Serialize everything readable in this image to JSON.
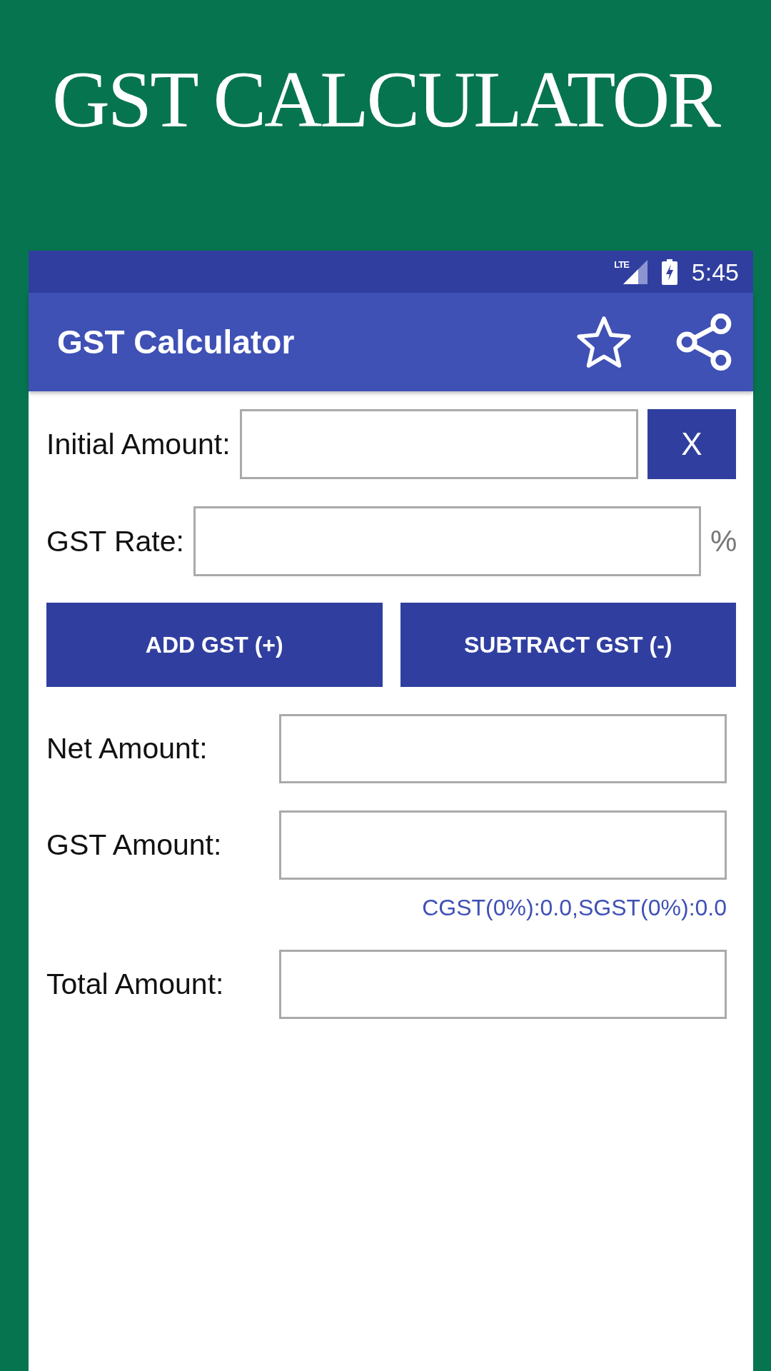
{
  "banner": {
    "title": "GST CALCULATOR"
  },
  "status_bar": {
    "network": "LTE",
    "time": "5:45"
  },
  "app_bar": {
    "title": "GST Calculator"
  },
  "inputs": [
    {
      "label": "Initial Amount:",
      "clear_button": "X"
    },
    {
      "label": "GST Rate:",
      "suffix": "%"
    }
  ],
  "actions": [
    {
      "label": "ADD GST (+)"
    },
    {
      "label": "SUBTRACT GST (-)"
    }
  ],
  "results": [
    {
      "label": "Net Amount:"
    },
    {
      "label": "GST Amount:",
      "note": "CGST(0%):0.0,SGST(0%):0.0"
    },
    {
      "label": "Total Amount:"
    }
  ]
}
